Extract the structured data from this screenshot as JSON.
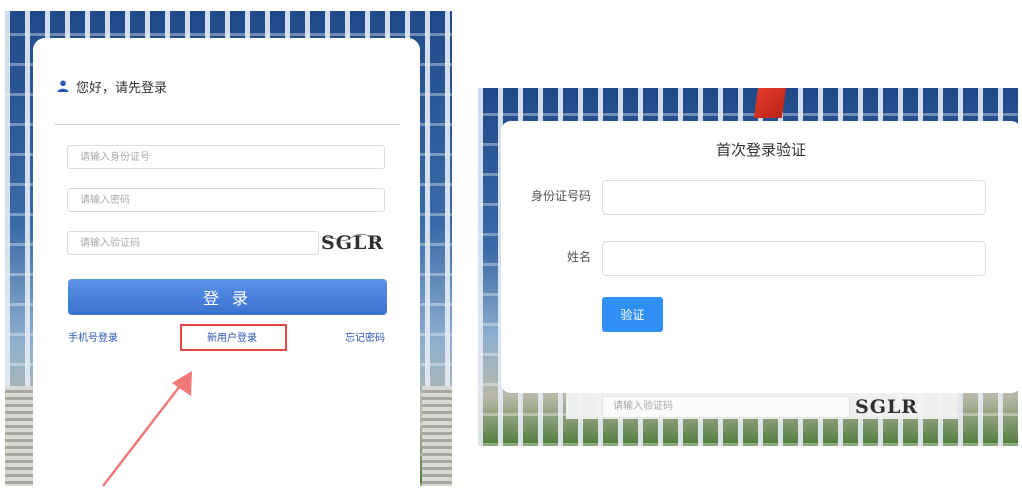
{
  "login": {
    "greeting": "您好，请先登录",
    "id_placeholder": "请输入身份证号",
    "password_placeholder": "请输入密码",
    "captcha_placeholder": "请输入验证码",
    "captcha_text": "SGLR",
    "login_button": "登 录",
    "links": {
      "phone_login": "手机号登录",
      "new_user_login": "新用户登录",
      "forgot_password": "忘记密码"
    }
  },
  "verify_dialog": {
    "title": "首次登录验证",
    "id_label": "身份证号码",
    "name_label": "姓名",
    "verify_button": "验证"
  },
  "background_form": {
    "captcha_placeholder": "请输入验证码",
    "captcha_text": "SGLR"
  },
  "colors": {
    "link": "#2b56b3",
    "login_button": "#4a84dc",
    "verify_button": "#2f8ff5",
    "highlight": "#e64545"
  },
  "icons": {
    "user": "user-icon",
    "annotation_arrow": "arrow-icon"
  }
}
